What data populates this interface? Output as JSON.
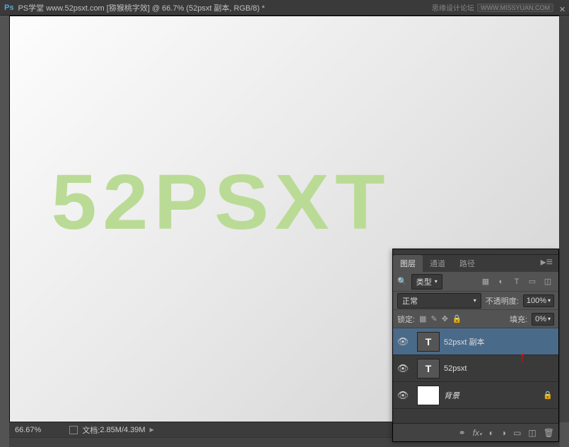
{
  "title_bar": {
    "app": "Ps",
    "doc_title": "PS学堂 www.52psxt.com [猕猴桃字效] @ 66.7% (52psxt 副本, RGB/8) *",
    "watermark_text": "思缘设计论坛",
    "watermark_badge": "WWW.MISSYUAN.COM"
  },
  "canvas": {
    "main_text": "52PSXT"
  },
  "status": {
    "zoom": "66.67%",
    "doc_label": "文档:",
    "doc_size": "2.85M/4.39M"
  },
  "panel": {
    "tabs": {
      "layers": "图层",
      "channels": "通道",
      "paths": "路径"
    },
    "filter_kind": "类型",
    "blend_mode": "正常",
    "opacity_label": "不透明度:",
    "opacity_value": "100%",
    "lock_label": "锁定:",
    "fill_label": "填充:",
    "fill_value": "0%",
    "layers": [
      {
        "name": "52psxt 副本",
        "thumb": "T",
        "visible": true,
        "selected": true
      },
      {
        "name": "52psxt",
        "thumb": "T",
        "visible": true,
        "selected": false
      },
      {
        "name": "背景",
        "thumb": "bg",
        "visible": true,
        "selected": false,
        "locked": true,
        "italic": true
      }
    ],
    "footer_icons": [
      "link",
      "fx",
      "mask",
      "adjust",
      "group",
      "new",
      "trash"
    ]
  }
}
